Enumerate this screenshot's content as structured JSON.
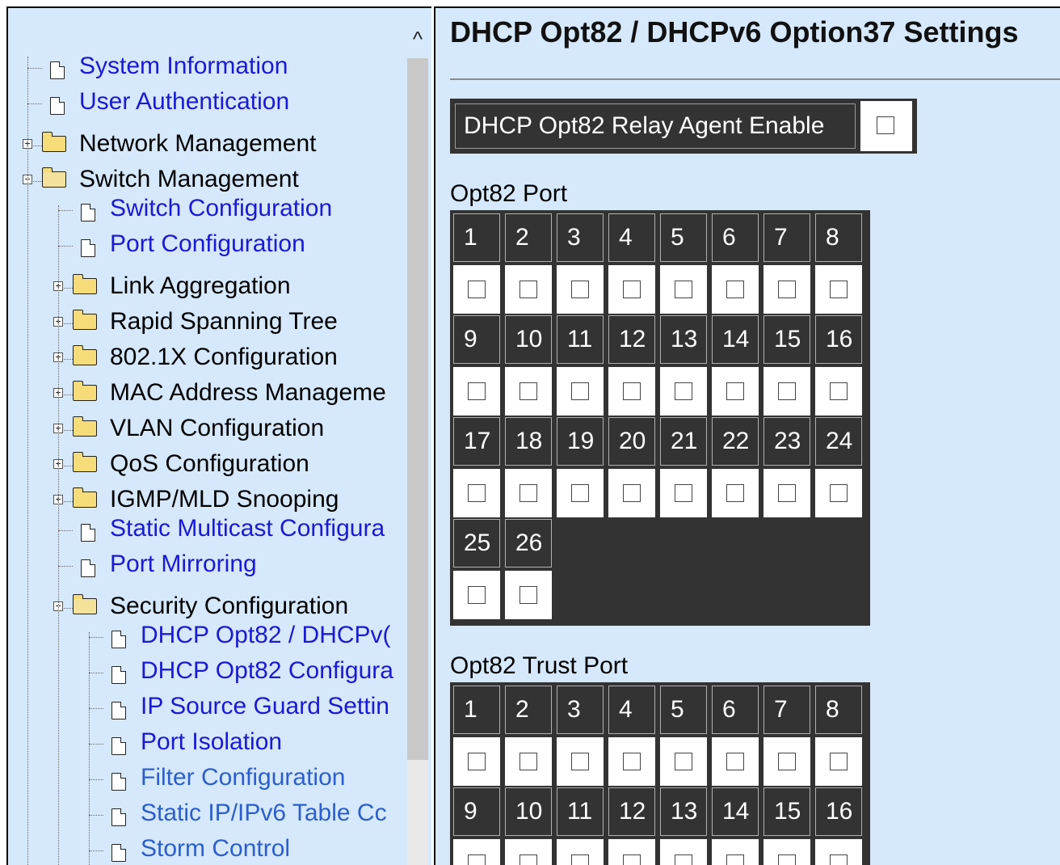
{
  "nav": {
    "items": [
      {
        "label": "System Information",
        "type": "link",
        "level": 0
      },
      {
        "label": "User Authentication",
        "type": "link",
        "level": 0
      },
      {
        "label": "Network Management",
        "type": "folder",
        "level": 0,
        "expanded": false
      },
      {
        "label": "Switch Management",
        "type": "folder",
        "level": 0,
        "expanded": true
      },
      {
        "label": "Switch Configuration",
        "type": "link",
        "level": 1
      },
      {
        "label": "Port Configuration",
        "type": "link",
        "level": 1
      },
      {
        "label": "Link Aggregation",
        "type": "folder",
        "level": 1,
        "expanded": false
      },
      {
        "label": "Rapid Spanning Tree",
        "type": "folder",
        "level": 1,
        "expanded": false
      },
      {
        "label": "802.1X Configuration",
        "type": "folder",
        "level": 1,
        "expanded": false
      },
      {
        "label": "MAC Address Manageme",
        "type": "folder",
        "level": 1,
        "expanded": false
      },
      {
        "label": "VLAN Configuration",
        "type": "folder",
        "level": 1,
        "expanded": false
      },
      {
        "label": "QoS Configuration",
        "type": "folder",
        "level": 1,
        "expanded": false
      },
      {
        "label": "IGMP/MLD Snooping",
        "type": "folder",
        "level": 1,
        "expanded": false
      },
      {
        "label": "Static Multicast Configura",
        "type": "link",
        "level": 1
      },
      {
        "label": "Port Mirroring",
        "type": "link",
        "level": 1
      },
      {
        "label": "Security Configuration",
        "type": "folder",
        "level": 1,
        "expanded": true
      },
      {
        "label": "DHCP Opt82 / DHCPv(",
        "type": "link",
        "level": 2
      },
      {
        "label": "DHCP Opt82 Configura",
        "type": "link",
        "level": 2
      },
      {
        "label": "IP Source Guard Settin",
        "type": "link",
        "level": 2
      },
      {
        "label": "Port Isolation",
        "type": "link",
        "level": 2
      },
      {
        "label": "Filter Configuration",
        "type": "link",
        "level": 2,
        "dim": true
      },
      {
        "label": "Static IP/IPv6 Table Cc",
        "type": "link",
        "level": 2,
        "dim": true
      },
      {
        "label": "Storm Control",
        "type": "link",
        "level": 2,
        "dim": true
      }
    ],
    "scroll_up_glyph": "^"
  },
  "main": {
    "title": "DHCP Opt82 / DHCPv6 Option37 Settings",
    "relay_agent": {
      "label": "DHCP Opt82 Relay Agent Enable",
      "checked": false
    },
    "opt82_port": {
      "label": "Opt82 Port",
      "ports": [
        "1",
        "2",
        "3",
        "4",
        "5",
        "6",
        "7",
        "8",
        "9",
        "10",
        "11",
        "12",
        "13",
        "14",
        "15",
        "16",
        "17",
        "18",
        "19",
        "20",
        "21",
        "22",
        "23",
        "24",
        "25",
        "26"
      ]
    },
    "opt82_trust_port": {
      "label": "Opt82 Trust Port",
      "ports": [
        "1",
        "2",
        "3",
        "4",
        "5",
        "6",
        "7",
        "8",
        "9",
        "10",
        "11",
        "12",
        "13",
        "14",
        "15",
        "16"
      ]
    }
  }
}
